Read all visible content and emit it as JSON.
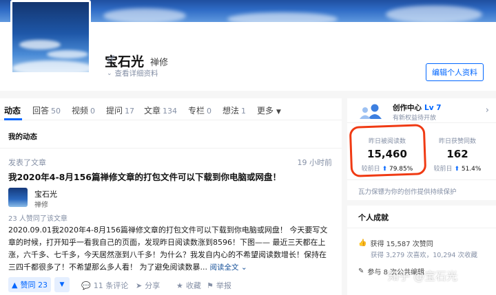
{
  "profile": {
    "name": "宝石光",
    "headline": "禅修",
    "gender_icon": "male-icon",
    "details_link": "查看详细资料",
    "edit_button": "编辑个人资料"
  },
  "tabs": [
    {
      "label": "动态",
      "count": ""
    },
    {
      "label": "回答",
      "count": "50"
    },
    {
      "label": "视频",
      "count": "0"
    },
    {
      "label": "提问",
      "count": "17"
    },
    {
      "label": "文章",
      "count": "134"
    },
    {
      "label": "专栏",
      "count": "0"
    },
    {
      "label": "想法",
      "count": "1"
    },
    {
      "label": "更多",
      "count": ""
    }
  ],
  "feed": {
    "section_title": "我的动态",
    "item": {
      "action": "发表了文章",
      "time": "19 小时前",
      "title": "我2020年4-8月156篇禅修文章的打包文件可以下载到你电脑或网盘！",
      "author_name": "宝石光",
      "author_headline": "禅修",
      "upvote_info": "23 人赞同了该文章",
      "excerpt": "2020.09.01我2020年4-8月156篇禅修文章的打包文件可以下载到你电脑或网盘！ 今天要写文章的时候，打开知乎一看我自己的页面，发现昨日阅读数涨到8596！下图—— 最近三天都在上涨，六千多、七千多，今天居然涨到八千多！为什么？我发自内心的不希望阅读数增长！保持在三四千都很多了！不希望那么多人看！ 为了避免阅读数暴...",
      "read_more": "阅读全文",
      "actions": {
        "vote": "赞同 23",
        "comments": "11 条评论",
        "share": "分享",
        "collect": "收藏",
        "report": "举报"
      }
    }
  },
  "creator": {
    "title": "创作中心",
    "level": "Lv 7",
    "subtitle": "有新权益待开放",
    "stats": [
      {
        "label": "昨日被阅读数",
        "value": "15,460",
        "change_prefix": "较前日",
        "change": "79.85%"
      },
      {
        "label": "昨日获赞同数",
        "value": "162",
        "change_prefix": "较前日",
        "change": "51.4%"
      }
    ],
    "protect_text": "瓦力保镖为你的创作提供持续保护"
  },
  "achievements": {
    "title": "个人成就",
    "upvotes": "获得 15,587 次赞同",
    "details": "获得 3,279 次喜欢，10,294 次收藏",
    "participation": "参与 8 次公共编辑"
  },
  "watermark": "知乎 @宝石光",
  "colors": {
    "accent": "#0066ff",
    "highlight": "#f03a13"
  }
}
